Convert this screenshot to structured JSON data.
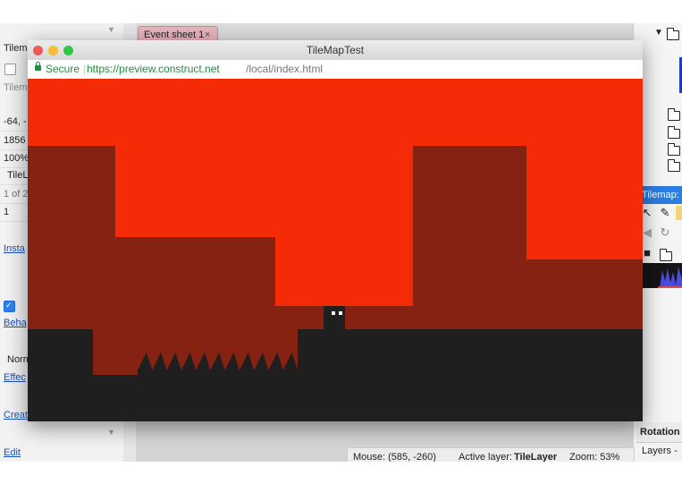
{
  "editor": {
    "tab_label": "Event sheet 1",
    "tab_close": "×",
    "left_panel": {
      "header": "Tilem",
      "subheader": "Tilem",
      "values": [
        "-64, -",
        "1856",
        "100%",
        "TileL",
        "1 of 2",
        "1"
      ],
      "instance_link": "Insta",
      "behaviors_link": "Beha",
      "blend_value": "Norm",
      "effects_link": "Effec",
      "create_link": "Creat",
      "edit_link": "Edit",
      "dropdown_arrow": "▼"
    },
    "right_panel": {
      "tree_arrow": "▼",
      "tilemap_header": "Tilemap: T",
      "rotation_label": "Rotation",
      "layers_label": "Layers -"
    },
    "status_bar": {
      "mouse_label": "Mouse: (585, -260)",
      "active_layer_label": "Active layer:",
      "active_layer_value": "TileLayer",
      "zoom_label": "Zoom: 53%"
    }
  },
  "preview_window": {
    "title": "TileMapTest",
    "secure_label": "Secure",
    "url_host": "https://preview.construct.net",
    "url_path": "/local/index.html"
  },
  "game": {
    "colors": {
      "sky": "#f52a06",
      "wall": "#852212",
      "ground": "#1f1f1f",
      "player": "#1f1f1f",
      "player_eyes": "#ffffff"
    },
    "spike_count": 11
  },
  "colors": {
    "traffic_close": "#ee5b50",
    "traffic_minimize": "#f6be33",
    "traffic_zoom": "#2fc843",
    "secure_green": "#1e8e3e",
    "link_blue": "#1a4fb8",
    "tab_pink": "#e8b4bc",
    "selection_blue": "#2b7de0"
  },
  "icons": [
    "lock-icon",
    "folder-icon",
    "pointer-icon",
    "pencil-icon",
    "eraser-icon",
    "rotate-icon",
    "dropdown-arrow-icon",
    "close-icon"
  ]
}
